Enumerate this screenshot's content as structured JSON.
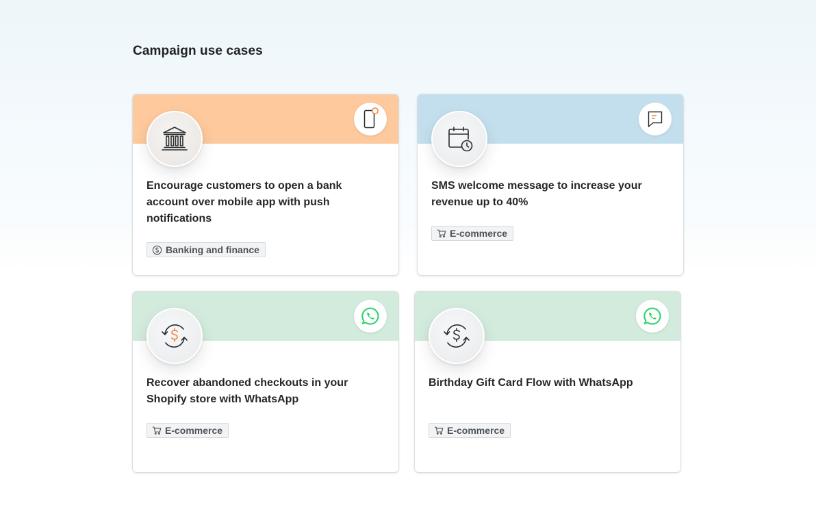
{
  "page": {
    "title": "Campaign use cases"
  },
  "cards": [
    {
      "title": "Encourage customers to open a bank account over mobile app with push notifications",
      "tag": "Banking and finance",
      "tag_icon": "dollar-circle-icon",
      "hero_icon": "bank-icon",
      "channel_icon": "mobile-push-icon",
      "band_color": "#fdc99d"
    },
    {
      "title": "SMS welcome message to increase your revenue up to 40%",
      "tag": "E-commerce",
      "tag_icon": "cart-icon",
      "hero_icon": "calendar-clock-icon",
      "channel_icon": "sms-icon",
      "band_color": "#c3dfed"
    },
    {
      "title": "Recover abandoned checkouts in your Shopify store with WhatsApp",
      "tag": "E-commerce",
      "tag_icon": "cart-icon",
      "hero_icon": "dollar-cycle-icon",
      "channel_icon": "whatsapp-icon",
      "band_color": "#d2ebdc"
    },
    {
      "title": "Birthday Gift Card Flow with WhatsApp",
      "tag": "E-commerce",
      "tag_icon": "cart-icon",
      "hero_icon": "dollar-cycle-icon",
      "channel_icon": "whatsapp-icon",
      "band_color": "#d2ebdc"
    }
  ],
  "colors": {
    "accent_orange": "#f07f3c",
    "whatsapp_green": "#25d366"
  }
}
